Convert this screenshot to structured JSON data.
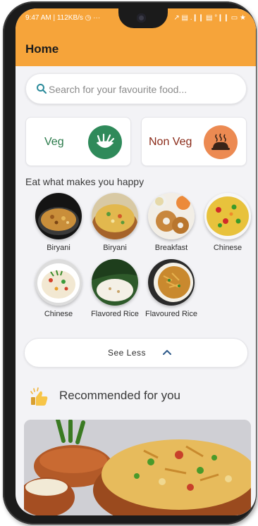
{
  "status_bar": {
    "left": "9:47 AM | 112KB/s ◷  ···",
    "right": "↗ ▤ .❙❙ ▤ °❙❙ ▭ ★"
  },
  "app": {
    "title": "Home"
  },
  "search": {
    "placeholder": "Search for your favourite food..."
  },
  "categories": [
    {
      "label": "Veg",
      "icon": "salad-bowl-icon",
      "color": "#2f8a5a"
    },
    {
      "label": "Non Veg",
      "icon": "roast-chicken-icon",
      "color": "#ec8a52"
    }
  ],
  "section_heading": "Eat what makes you happy",
  "foods": [
    {
      "label": "Biryani"
    },
    {
      "label": "Biryani"
    },
    {
      "label": "Breakfast"
    },
    {
      "label": "Chinese"
    },
    {
      "label": "Chinese"
    },
    {
      "label": "Flavored Rice"
    },
    {
      "label": "Flavoured Rice"
    }
  ],
  "see_less": {
    "label": "See Less"
  },
  "recommended": {
    "title": "Recommended for you",
    "icon": "thumbs-up-icon"
  },
  "colors": {
    "accent": "#f6a43a",
    "veg": "#2f8a5a",
    "nonveg": "#ec8a52"
  }
}
